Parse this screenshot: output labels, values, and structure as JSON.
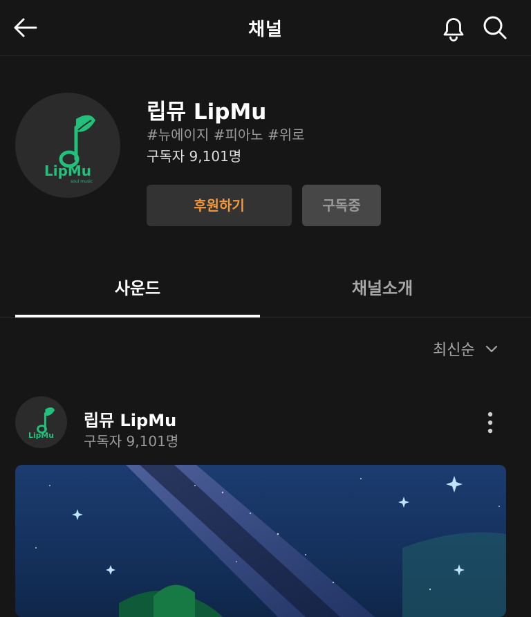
{
  "header": {
    "title": "채널",
    "icons": [
      "back-arrow-icon",
      "bell-icon",
      "search-icon"
    ]
  },
  "channel": {
    "name": "립뮤 LipMu",
    "tags": "#뉴에이지 #피아노 #위로",
    "subscribers": "구독자 9,101명",
    "logo": {
      "text": "LipMu",
      "subtext": "soul music",
      "color": "#22c07a"
    },
    "support_button": "후원하기",
    "subscribed_button": "구독중"
  },
  "tabs": [
    {
      "label": "사운드",
      "active": true
    },
    {
      "label": "채널소개",
      "active": false
    }
  ],
  "sort": {
    "label": "최신순"
  },
  "post": {
    "channel_name": "립뮤 LipMu",
    "subscribers": "구독자 9,101명",
    "thumbnail": "night sky milky way with stars over green hills"
  },
  "colors": {
    "background": "#161616",
    "accent": "#f3993d",
    "logo_green": "#22c07a"
  }
}
